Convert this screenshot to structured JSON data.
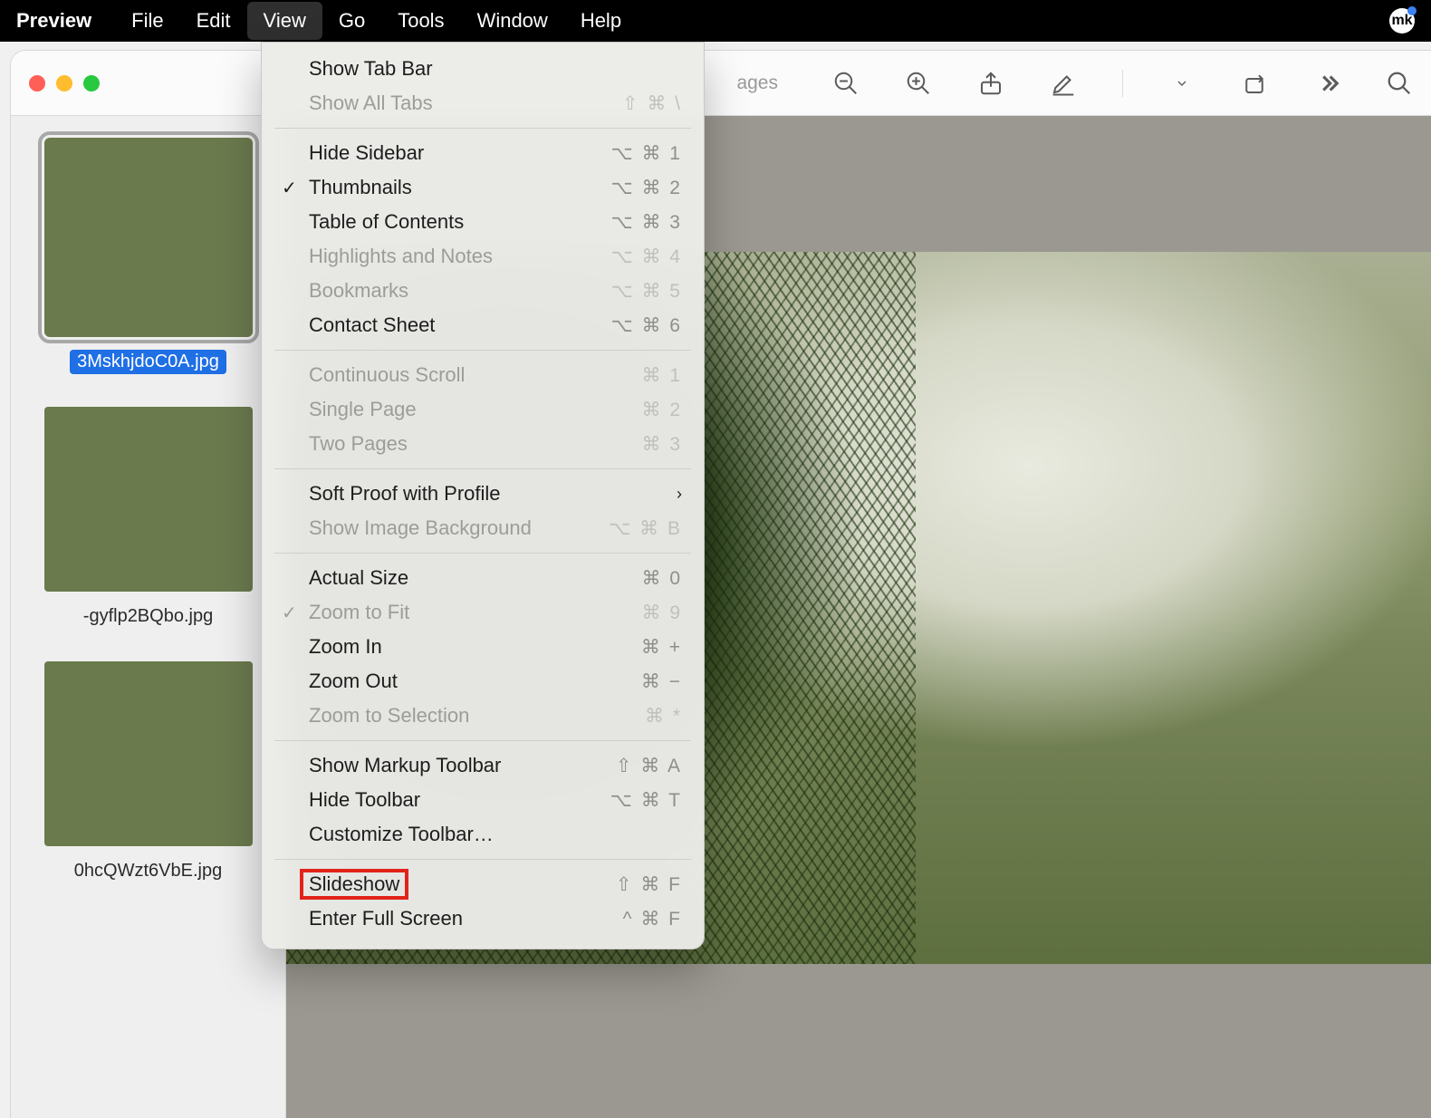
{
  "menubar": {
    "app": "Preview",
    "items": [
      "File",
      "Edit",
      "View",
      "Go",
      "Tools",
      "Window",
      "Help"
    ],
    "active_index": 2
  },
  "window": {
    "title": "",
    "subtitle_suffix": "ages",
    "traffic": {
      "close": "#ff5f57",
      "min": "#febc2e",
      "max": "#28c840"
    }
  },
  "toolbar_icons": [
    "zoom-out-icon",
    "zoom-in-icon",
    "share-icon",
    "markup-icon",
    "toolbar-divider",
    "dropdown-chevron-icon",
    "rotate-icon",
    "more-icon",
    "search-icon"
  ],
  "thumbnails": [
    {
      "caption": "3MskhjdoC0A.jpg",
      "selected": true,
      "kind": "pine"
    },
    {
      "caption": "-gyflp2BQbo.jpg",
      "selected": false,
      "kind": "branches"
    },
    {
      "caption": "0hcQWzt6VbE.jpg",
      "selected": false,
      "kind": "cat"
    }
  ],
  "dropdown": {
    "groups": [
      [
        {
          "label": "Show Tab Bar",
          "shortcut": "",
          "disabled": false
        },
        {
          "label": "Show All Tabs",
          "shortcut": "⇧ ⌘ \\",
          "disabled": true
        }
      ],
      [
        {
          "label": "Hide Sidebar",
          "shortcut": "⌥ ⌘ 1",
          "disabled": false
        },
        {
          "label": "Thumbnails",
          "shortcut": "⌥ ⌘ 2",
          "disabled": false,
          "checked": true
        },
        {
          "label": "Table of Contents",
          "shortcut": "⌥ ⌘ 3",
          "disabled": false
        },
        {
          "label": "Highlights and Notes",
          "shortcut": "⌥ ⌘ 4",
          "disabled": true
        },
        {
          "label": "Bookmarks",
          "shortcut": "⌥ ⌘ 5",
          "disabled": true
        },
        {
          "label": "Contact Sheet",
          "shortcut": "⌥ ⌘ 6",
          "disabled": false
        }
      ],
      [
        {
          "label": "Continuous Scroll",
          "shortcut": "⌘ 1",
          "disabled": true
        },
        {
          "label": "Single Page",
          "shortcut": "⌘ 2",
          "disabled": true
        },
        {
          "label": "Two Pages",
          "shortcut": "⌘ 3",
          "disabled": true
        }
      ],
      [
        {
          "label": "Soft Proof with Profile",
          "shortcut": "",
          "disabled": false,
          "submenu": true
        },
        {
          "label": "Show Image Background",
          "shortcut": "⌥ ⌘ B",
          "disabled": true
        }
      ],
      [
        {
          "label": "Actual Size",
          "shortcut": "⌘ 0",
          "disabled": false
        },
        {
          "label": "Zoom to Fit",
          "shortcut": "⌘ 9",
          "disabled": true,
          "checked": true
        },
        {
          "label": "Zoom In",
          "shortcut": "⌘ +",
          "disabled": false
        },
        {
          "label": "Zoom Out",
          "shortcut": "⌘ −",
          "disabled": false
        },
        {
          "label": "Zoom to Selection",
          "shortcut": "⌘ *",
          "disabled": true
        }
      ],
      [
        {
          "label": "Show Markup Toolbar",
          "shortcut": "⇧ ⌘ A",
          "disabled": false
        },
        {
          "label": "Hide Toolbar",
          "shortcut": "⌥ ⌘ T",
          "disabled": false
        },
        {
          "label": "Customize Toolbar…",
          "shortcut": "",
          "disabled": false
        }
      ],
      [
        {
          "label": "Slideshow",
          "shortcut": "⇧ ⌘ F",
          "disabled": false,
          "annotated": true
        },
        {
          "label": "Enter Full Screen",
          "shortcut": "^ ⌘ F",
          "disabled": false
        }
      ]
    ]
  },
  "status": {
    "label": "mk"
  }
}
